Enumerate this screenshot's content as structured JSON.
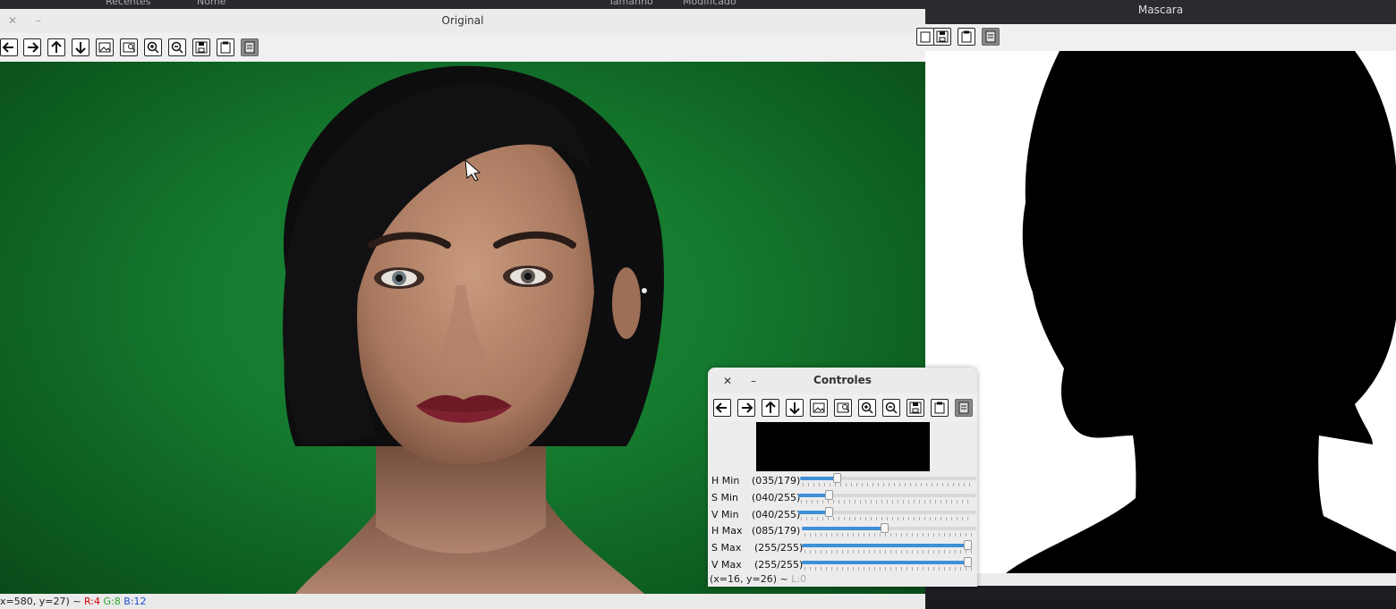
{
  "background_window": {
    "items": [
      "Recentes",
      "Nome",
      "Tamanho",
      "Modificado"
    ]
  },
  "original": {
    "title": "Original",
    "close_glyph": "✕",
    "minimize_glyph": "–",
    "status": {
      "coords": "x=580, y=27) ~",
      "r": "R:4",
      "g": "G:8",
      "b": "B:12"
    }
  },
  "mask": {
    "title": "Mascara"
  },
  "controls": {
    "title": "Controles",
    "close_glyph": "✕",
    "minimize_glyph": "–",
    "trackbars": [
      {
        "label": "H Min",
        "value_text": "(035/179)",
        "value": 35,
        "max": 179
      },
      {
        "label": "S Min",
        "value_text": "(040/255)",
        "value": 40,
        "max": 255
      },
      {
        "label": "V Min",
        "value_text": "(040/255)",
        "value": 40,
        "max": 255
      },
      {
        "label": "H Max",
        "value_text": "(085/179)",
        "value": 85,
        "max": 179
      },
      {
        "label": "S Max",
        "value_text": "(255/255)",
        "value": 255,
        "max": 255
      },
      {
        "label": "V Max",
        "value_text": "(255/255)",
        "value": 255,
        "max": 255
      }
    ],
    "status": {
      "coords": "(x=16, y=26) ~",
      "level": "L:0"
    }
  },
  "toolbar_icons": [
    "pan-left-icon",
    "pan-right-icon",
    "pan-up-icon",
    "pan-down-icon",
    "zoom-original-icon",
    "zoom-fit-icon",
    "zoom-in-icon",
    "zoom-out-icon",
    "save-icon",
    "copy-clipboard-icon",
    "properties-icon"
  ],
  "colors": {
    "status_r": "#d40000",
    "status_g": "#2aa52a",
    "status_b": "#1f4fd6",
    "slider_fill": "#3d8fd6",
    "chroma_green": "#1b8a38"
  }
}
